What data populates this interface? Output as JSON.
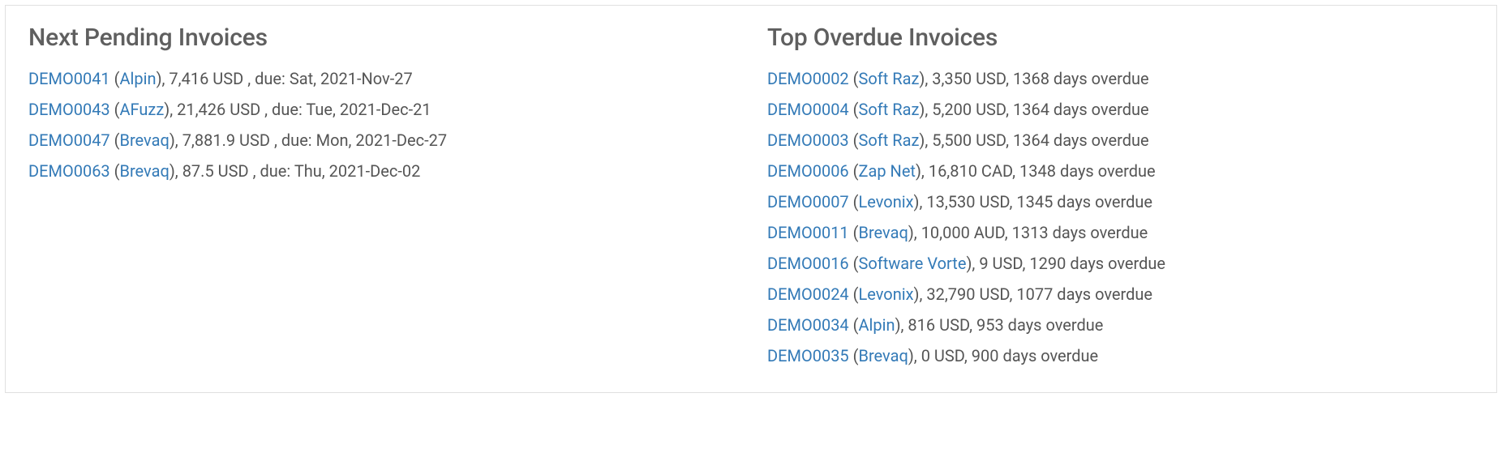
{
  "pending": {
    "title": "Next Pending Invoices",
    "items": [
      {
        "id": "DEMO0041",
        "client": "Alpin",
        "amount": "7,416 USD",
        "due": "Sat, 2021-Nov-27"
      },
      {
        "id": "DEMO0043",
        "client": "AFuzz",
        "amount": "21,426 USD",
        "due": "Tue, 2021-Dec-21"
      },
      {
        "id": "DEMO0047",
        "client": "Brevaq",
        "amount": "7,881.9 USD",
        "due": "Mon, 2021-Dec-27"
      },
      {
        "id": "DEMO0063",
        "client": "Brevaq",
        "amount": "87.5 USD",
        "due": "Thu, 2021-Dec-02"
      }
    ]
  },
  "overdue": {
    "title": "Top Overdue Invoices",
    "items": [
      {
        "id": "DEMO0002",
        "client": "Soft Raz",
        "amount": "3,350 USD",
        "days": "1368"
      },
      {
        "id": "DEMO0004",
        "client": "Soft Raz",
        "amount": "5,200 USD",
        "days": "1364"
      },
      {
        "id": "DEMO0003",
        "client": "Soft Raz",
        "amount": "5,500 USD",
        "days": "1364"
      },
      {
        "id": "DEMO0006",
        "client": "Zap Net",
        "amount": "16,810 CAD",
        "days": "1348"
      },
      {
        "id": "DEMO0007",
        "client": "Levonix",
        "amount": "13,530 USD",
        "days": "1345"
      },
      {
        "id": "DEMO0011",
        "client": "Brevaq",
        "amount": "10,000 AUD",
        "days": "1313"
      },
      {
        "id": "DEMO0016",
        "client": "Software Vorte",
        "amount": "9 USD",
        "days": "1290"
      },
      {
        "id": "DEMO0024",
        "client": "Levonix",
        "amount": "32,790 USD",
        "days": "1077"
      },
      {
        "id": "DEMO0034",
        "client": "Alpin",
        "amount": "816 USD",
        "days": "953"
      },
      {
        "id": "DEMO0035",
        "client": "Brevaq",
        "amount": "0 USD",
        "days": "900"
      }
    ]
  }
}
